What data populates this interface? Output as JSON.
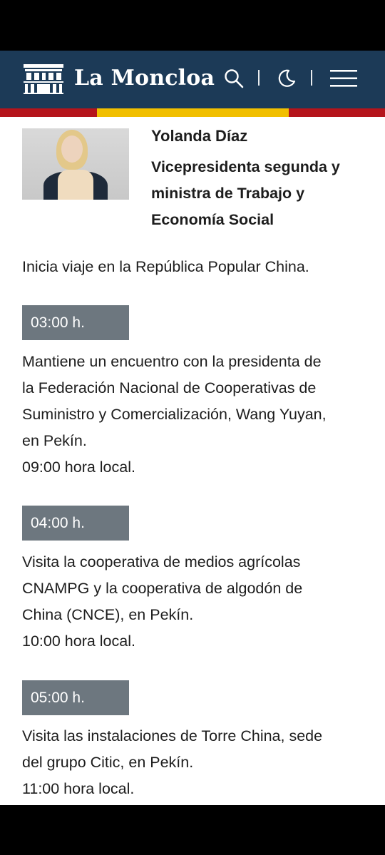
{
  "header": {
    "site_name": "La Moncloa",
    "colors": {
      "header_bg": "#1c3a57",
      "flag_red": "#b5141b",
      "flag_yellow": "#f1bf00",
      "time_badge": "#6d777f"
    },
    "icons": [
      "moncloa-logo-icon",
      "search-icon",
      "dark-mode-icon",
      "menu-icon"
    ]
  },
  "profile": {
    "name": "Yolanda Díaz",
    "role_lines": [
      "Vicepresidenta segunda y",
      "ministra de Trabajo y",
      "Economía Social"
    ]
  },
  "intro": "Inicia viaje en la República Popular China.",
  "events": [
    {
      "time": "03:00 h.",
      "lines": [
        "Mantiene un encuentro con la presidenta de",
        "la Federación Nacional de Cooperativas de",
        "Suministro y Comercialización, Wang Yuyan,",
        "en Pekín."
      ],
      "local": "09:00 hora local."
    },
    {
      "time": "04:00 h.",
      "lines": [
        "Visita la cooperativa de medios agrícolas",
        "CNAMPG y la cooperativa de algodón de",
        "China (CNCE), en Pekín."
      ],
      "local": "10:00 hora local."
    },
    {
      "time": "05:00 h.",
      "lines": [
        "Visita las instalaciones de Torre China, sede",
        "del grupo Citic, en Pekín."
      ],
      "local": "11:00 hora local."
    }
  ]
}
